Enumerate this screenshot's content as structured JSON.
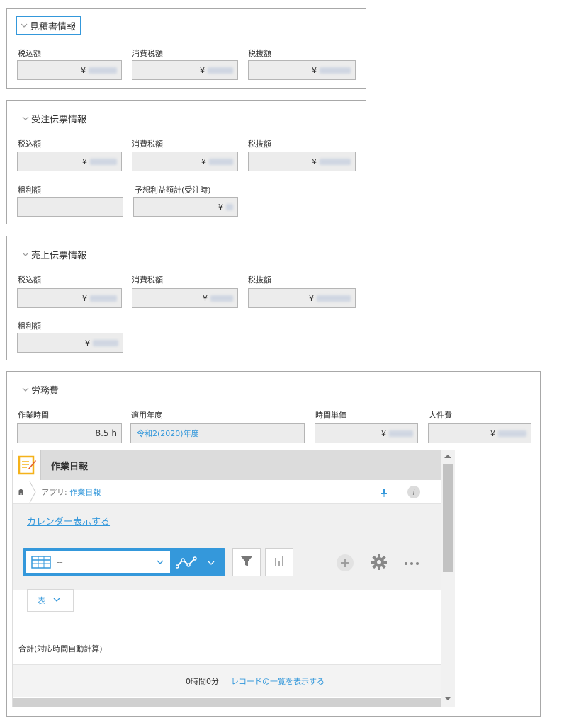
{
  "estimate": {
    "title": "見積書情報",
    "fields": [
      {
        "label": "税込額",
        "currency": "¥"
      },
      {
        "label": "消費税額",
        "currency": "¥"
      },
      {
        "label": "税抜額",
        "currency": "¥"
      }
    ]
  },
  "order": {
    "title": "受注伝票情報",
    "fields": [
      {
        "label": "税込額",
        "currency": "¥"
      },
      {
        "label": "消費税額",
        "currency": "¥"
      },
      {
        "label": "税抜額",
        "currency": "¥"
      },
      {
        "label": "粗利額",
        "currency": ""
      },
      {
        "label": "予想利益額計(受注時)",
        "currency": "¥"
      }
    ]
  },
  "sales": {
    "title": "売上伝票情報",
    "fields": [
      {
        "label": "税込額",
        "currency": "¥"
      },
      {
        "label": "消費税額",
        "currency": "¥"
      },
      {
        "label": "税抜額",
        "currency": "¥"
      },
      {
        "label": "粗利額",
        "currency": "¥"
      }
    ]
  },
  "labor": {
    "title": "労務費",
    "fields": [
      {
        "label": "作業時間",
        "value": "8.5 h"
      },
      {
        "label": "適用年度",
        "value": "令和2(2020)年度"
      },
      {
        "label": "時間単価",
        "currency": "¥"
      },
      {
        "label": "人件費",
        "currency": "¥"
      }
    ]
  },
  "app": {
    "title": "作業日報",
    "breadcrumb_prefix": "アプリ: ",
    "breadcrumb_app": "作業日報",
    "info_label": "i",
    "calendar_link": "カレンダー表示する",
    "view_value": "--",
    "table_select": "表",
    "table_header": "合計(対応時間自動計算)",
    "total_value": "0時間0分",
    "record_link": "レコードの一覧を表示する"
  },
  "colors": {
    "accent": "#3498db",
    "notepad": "#f5b21a"
  }
}
